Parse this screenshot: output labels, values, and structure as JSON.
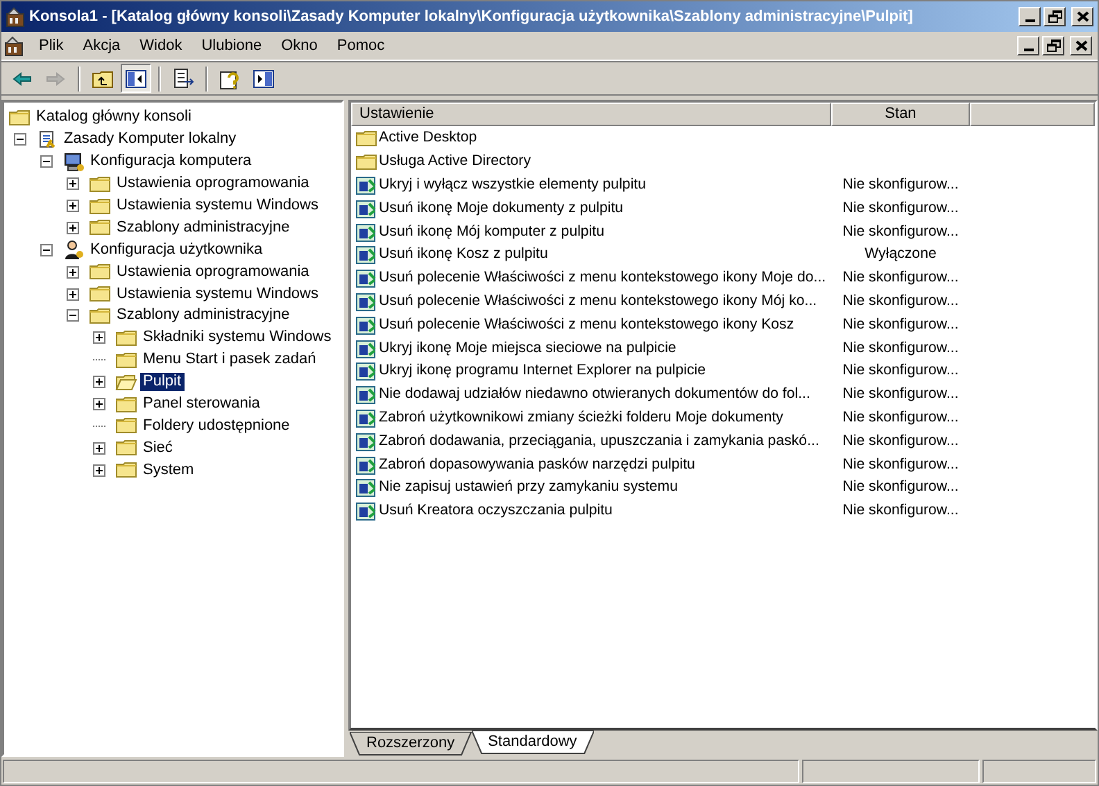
{
  "window": {
    "title": "Konsola1 - [Katalog główny konsoli\\Zasady Komputer lokalny\\Konfiguracja użytkownika\\Szablony administracyjne\\Pulpit]"
  },
  "menu": [
    "Plik",
    "Akcja",
    "Widok",
    "Ulubione",
    "Okno",
    "Pomoc"
  ],
  "toolbar": [
    {
      "kind": "back",
      "disabled": false
    },
    {
      "kind": "forward",
      "disabled": true
    },
    {
      "kind": "sep"
    },
    {
      "kind": "up",
      "disabled": false
    },
    {
      "kind": "tree",
      "disabled": false,
      "pressed": true
    },
    {
      "kind": "sep"
    },
    {
      "kind": "export",
      "disabled": false
    },
    {
      "kind": "sep"
    },
    {
      "kind": "help",
      "disabled": false
    },
    {
      "kind": "actionpane",
      "disabled": false
    }
  ],
  "tree": [
    {
      "label": "Katalog główny konsoli",
      "kind": "folder",
      "selected": false,
      "children": [
        {
          "label": "Zasady Komputer lokalny",
          "kind": "policy",
          "expanded": true,
          "selected": false,
          "children": [
            {
              "label": "Konfiguracja komputera",
              "kind": "computer",
              "expanded": true,
              "selected": false,
              "children": [
                {
                  "label": "Ustawienia oprogramowania",
                  "kind": "folder",
                  "expanded": false,
                  "selected": false
                },
                {
                  "label": "Ustawienia systemu Windows",
                  "kind": "folder",
                  "expanded": false,
                  "selected": false
                },
                {
                  "label": "Szablony administracyjne",
                  "kind": "folder",
                  "expanded": false,
                  "selected": false
                }
              ]
            },
            {
              "label": "Konfiguracja użytkownika",
              "kind": "user",
              "expanded": true,
              "selected": false,
              "children": [
                {
                  "label": "Ustawienia oprogramowania",
                  "kind": "folder",
                  "expanded": false,
                  "selected": false
                },
                {
                  "label": "Ustawienia systemu Windows",
                  "kind": "folder",
                  "expanded": false,
                  "selected": false
                },
                {
                  "label": "Szablony administracyjne",
                  "kind": "folder",
                  "expanded": true,
                  "selected": false,
                  "children": [
                    {
                      "label": "Składniki systemu Windows",
                      "kind": "folder",
                      "expanded": false,
                      "selected": false
                    },
                    {
                      "label": "Menu Start i pasek zadań",
                      "kind": "folder",
                      "selected": false
                    },
                    {
                      "label": "Pulpit",
                      "kind": "openfolder",
                      "expanded": false,
                      "selected": true
                    },
                    {
                      "label": "Panel sterowania",
                      "kind": "folder",
                      "expanded": false,
                      "selected": false
                    },
                    {
                      "label": "Foldery udostępnione",
                      "kind": "folder",
                      "selected": false
                    },
                    {
                      "label": "Sieć",
                      "kind": "folder",
                      "expanded": false,
                      "selected": false
                    },
                    {
                      "label": "System",
                      "kind": "folder",
                      "expanded": false,
                      "selected": false
                    }
                  ]
                }
              ]
            }
          ]
        }
      ]
    }
  ],
  "list": {
    "columns": [
      "Ustawienie",
      "Stan"
    ],
    "rows": [
      {
        "kind": "folder",
        "name": "Active Desktop"
      },
      {
        "kind": "folder",
        "name": "Usługa Active Directory"
      },
      {
        "kind": "setting",
        "name": "Ukryj i wyłącz wszystkie elementy pulpitu",
        "state": "Nie skonfigurow..."
      },
      {
        "kind": "setting",
        "name": "Usuń ikonę Moje dokumenty z pulpitu",
        "state": "Nie skonfigurow..."
      },
      {
        "kind": "setting",
        "name": "Usuń ikonę Mój komputer z pulpitu",
        "state": "Nie skonfigurow..."
      },
      {
        "kind": "setting",
        "name": "Usuń ikonę Kosz z pulpitu",
        "state": "Wyłączone"
      },
      {
        "kind": "setting",
        "name": "Usuń polecenie Właściwości z menu kontekstowego ikony Moje do...",
        "state": "Nie skonfigurow..."
      },
      {
        "kind": "setting",
        "name": "Usuń polecenie Właściwości z menu kontekstowego ikony Mój ko...",
        "state": "Nie skonfigurow..."
      },
      {
        "kind": "setting",
        "name": "Usuń polecenie Właściwości z menu kontekstowego ikony Kosz",
        "state": "Nie skonfigurow..."
      },
      {
        "kind": "setting",
        "name": "Ukryj ikonę Moje miejsca sieciowe na pulpicie",
        "state": "Nie skonfigurow..."
      },
      {
        "kind": "setting",
        "name": "Ukryj ikonę programu Internet Explorer na pulpicie",
        "state": "Nie skonfigurow..."
      },
      {
        "kind": "setting",
        "name": "Nie dodawaj udziałów niedawno otwieranych dokumentów do fol...",
        "state": "Nie skonfigurow..."
      },
      {
        "kind": "setting",
        "name": "Zabroń użytkownikowi zmiany ścieżki folderu Moje dokumenty",
        "state": "Nie skonfigurow..."
      },
      {
        "kind": "setting",
        "name": "Zabroń dodawania, przeciągania, upuszczania i zamykania paskó...",
        "state": "Nie skonfigurow..."
      },
      {
        "kind": "setting",
        "name": "Zabroń dopasowywania pasków narzędzi pulpitu",
        "state": "Nie skonfigurow..."
      },
      {
        "kind": "setting",
        "name": "Nie zapisuj ustawień przy zamykaniu systemu",
        "state": "Nie skonfigurow..."
      },
      {
        "kind": "setting",
        "name": "Usuń Kreatora oczyszczania pulpitu",
        "state": "Nie skonfigurow..."
      }
    ]
  },
  "tabs": [
    {
      "label": "Rozszerzony",
      "selected": false
    },
    {
      "label": "Standardowy",
      "selected": true
    }
  ]
}
